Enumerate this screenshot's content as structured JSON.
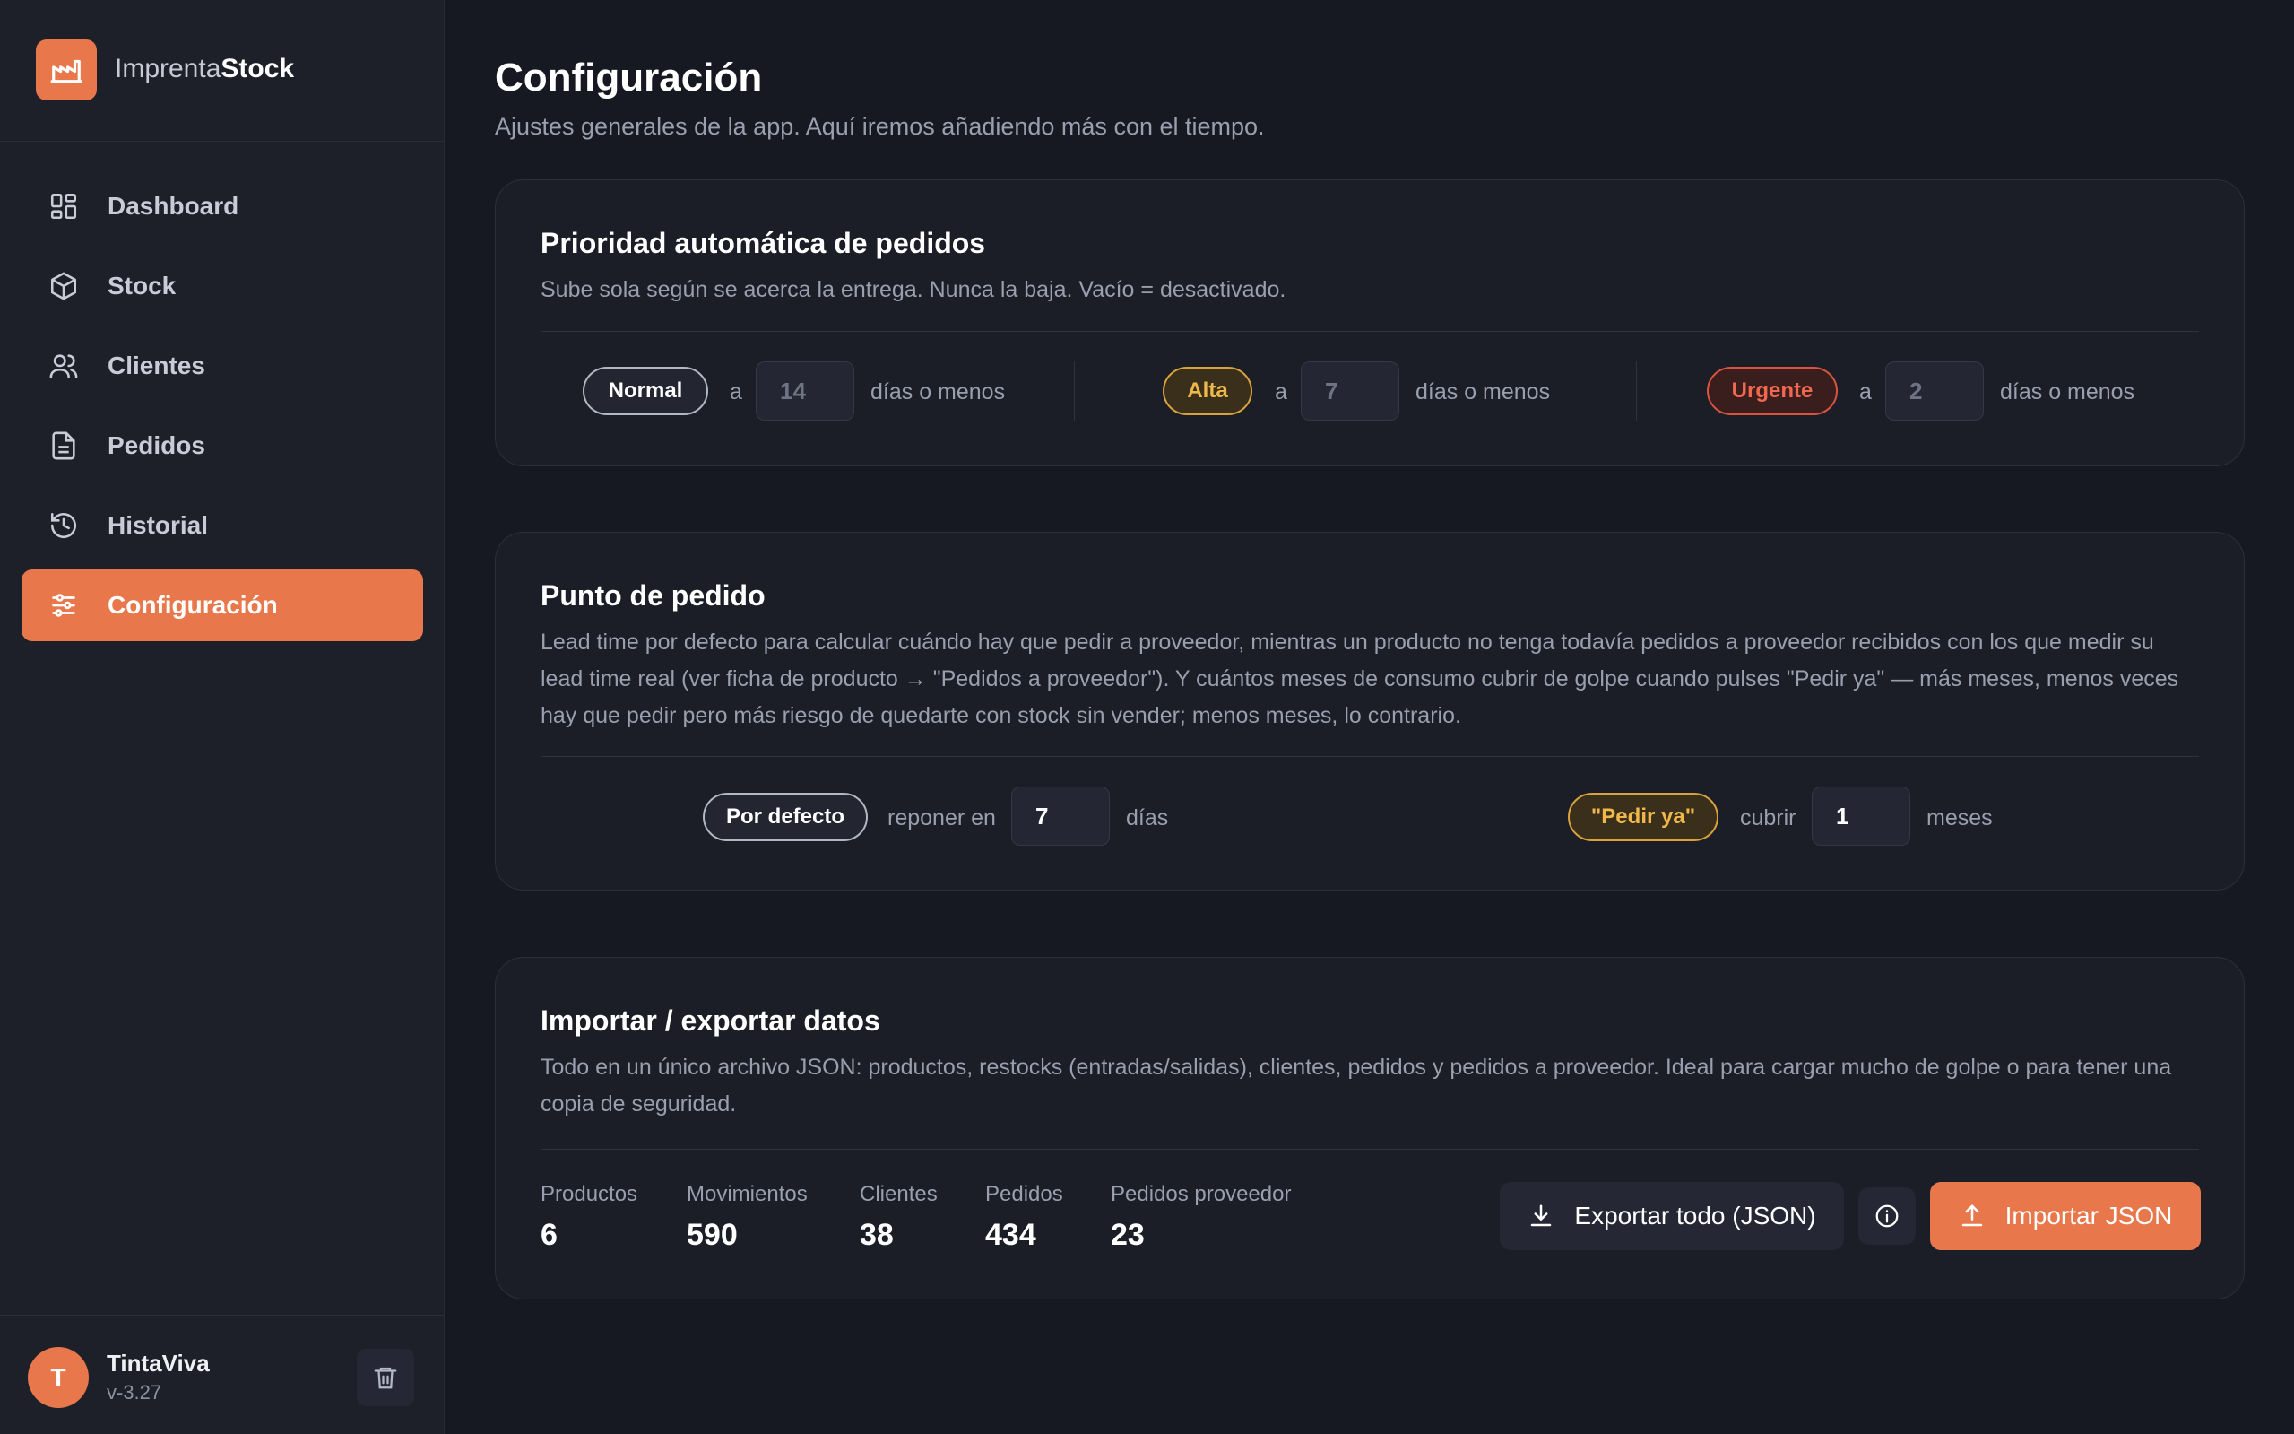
{
  "app": {
    "brand_regular": "Imprenta",
    "brand_bold": "Stock"
  },
  "colors": {
    "accent": "#e8774b",
    "alta": "#f0b84a",
    "urgente": "#f0684f"
  },
  "sidebar": {
    "items": [
      {
        "label": "Dashboard",
        "icon": "dashboard-icon"
      },
      {
        "label": "Stock",
        "icon": "box-icon"
      },
      {
        "label": "Clientes",
        "icon": "users-icon"
      },
      {
        "label": "Pedidos",
        "icon": "document-icon"
      },
      {
        "label": "Historial",
        "icon": "history-icon"
      },
      {
        "label": "Configuración",
        "icon": "sliders-icon",
        "active": true
      }
    ],
    "footer": {
      "avatar_letter": "T",
      "name": "TintaViva",
      "version": "v-3.27"
    }
  },
  "page": {
    "title": "Configuración",
    "subtitle": "Ajustes generales de la app. Aquí iremos añadiendo más con el tiempo."
  },
  "priority": {
    "title": "Prioridad automática de pedidos",
    "desc": "Sube sola según se acerca la entrega. Nunca la baja. Vacío = desactivado.",
    "connector": "a",
    "suffix": "días o menos",
    "levels": [
      {
        "label": "Normal",
        "placeholder": "14"
      },
      {
        "label": "Alta",
        "placeholder": "7"
      },
      {
        "label": "Urgente",
        "placeholder": "2"
      }
    ]
  },
  "reorder": {
    "title": "Punto de pedido",
    "desc": "Lead time por defecto para calcular cuándo hay que pedir a proveedor, mientras un producto no tenga todavía pedidos a proveedor recibidos con los que medir su lead time real (ver ficha de producto → \"Pedidos a proveedor\"). Y cuántos meses de consumo cubrir de golpe cuando pulses \"Pedir ya\" — más meses, menos veces hay que pedir pero más riesgo de quedarte con stock sin vender; menos meses, lo contrario.",
    "default_pill": "Por defecto",
    "default_label": "reponer en",
    "default_value": "7",
    "default_unit": "días",
    "pedir_pill": "\"Pedir ya\"",
    "pedir_label": "cubrir",
    "pedir_value": "1",
    "pedir_unit": "meses"
  },
  "data_io": {
    "title": "Importar / exportar datos",
    "desc": "Todo en un único archivo JSON: productos, restocks (entradas/salidas), clientes, pedidos y pedidos a proveedor. Ideal para cargar mucho de golpe o para tener una copia de seguridad.",
    "stats": [
      {
        "label": "Productos",
        "value": "6"
      },
      {
        "label": "Movimientos",
        "value": "590"
      },
      {
        "label": "Clientes",
        "value": "38"
      },
      {
        "label": "Pedidos",
        "value": "434"
      },
      {
        "label": "Pedidos proveedor",
        "value": "23"
      }
    ],
    "export_label": "Exportar todo (JSON)",
    "import_label": "Importar JSON"
  }
}
